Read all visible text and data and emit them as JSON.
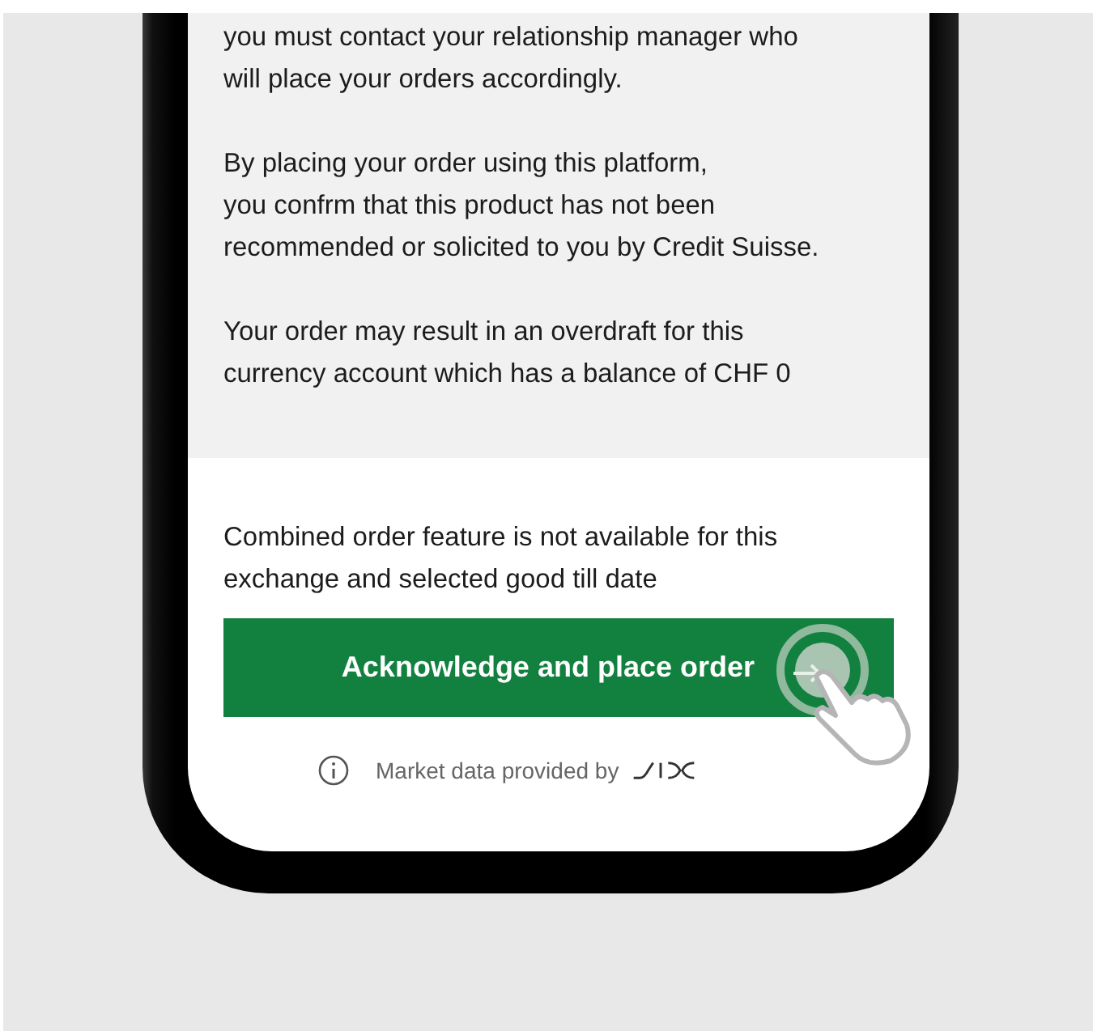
{
  "disclaimer": {
    "paragraphs": [
      "you must contact your relationship manager who\nwill place your orders accordingly.",
      "By placing your order using this platform,\nyou confrm that this product has not been\nrecommended or solicited to you by Credit Suisse.",
      "Your order may result in an overdraft for this\ncurrency account which has a balance of CHF 0"
    ]
  },
  "notice": "Combined order feature is not available for this\nexchange and selected good till date",
  "primary_button": {
    "label": "Acknowledge and place order"
  },
  "footer": {
    "text": "Market data provided by"
  }
}
